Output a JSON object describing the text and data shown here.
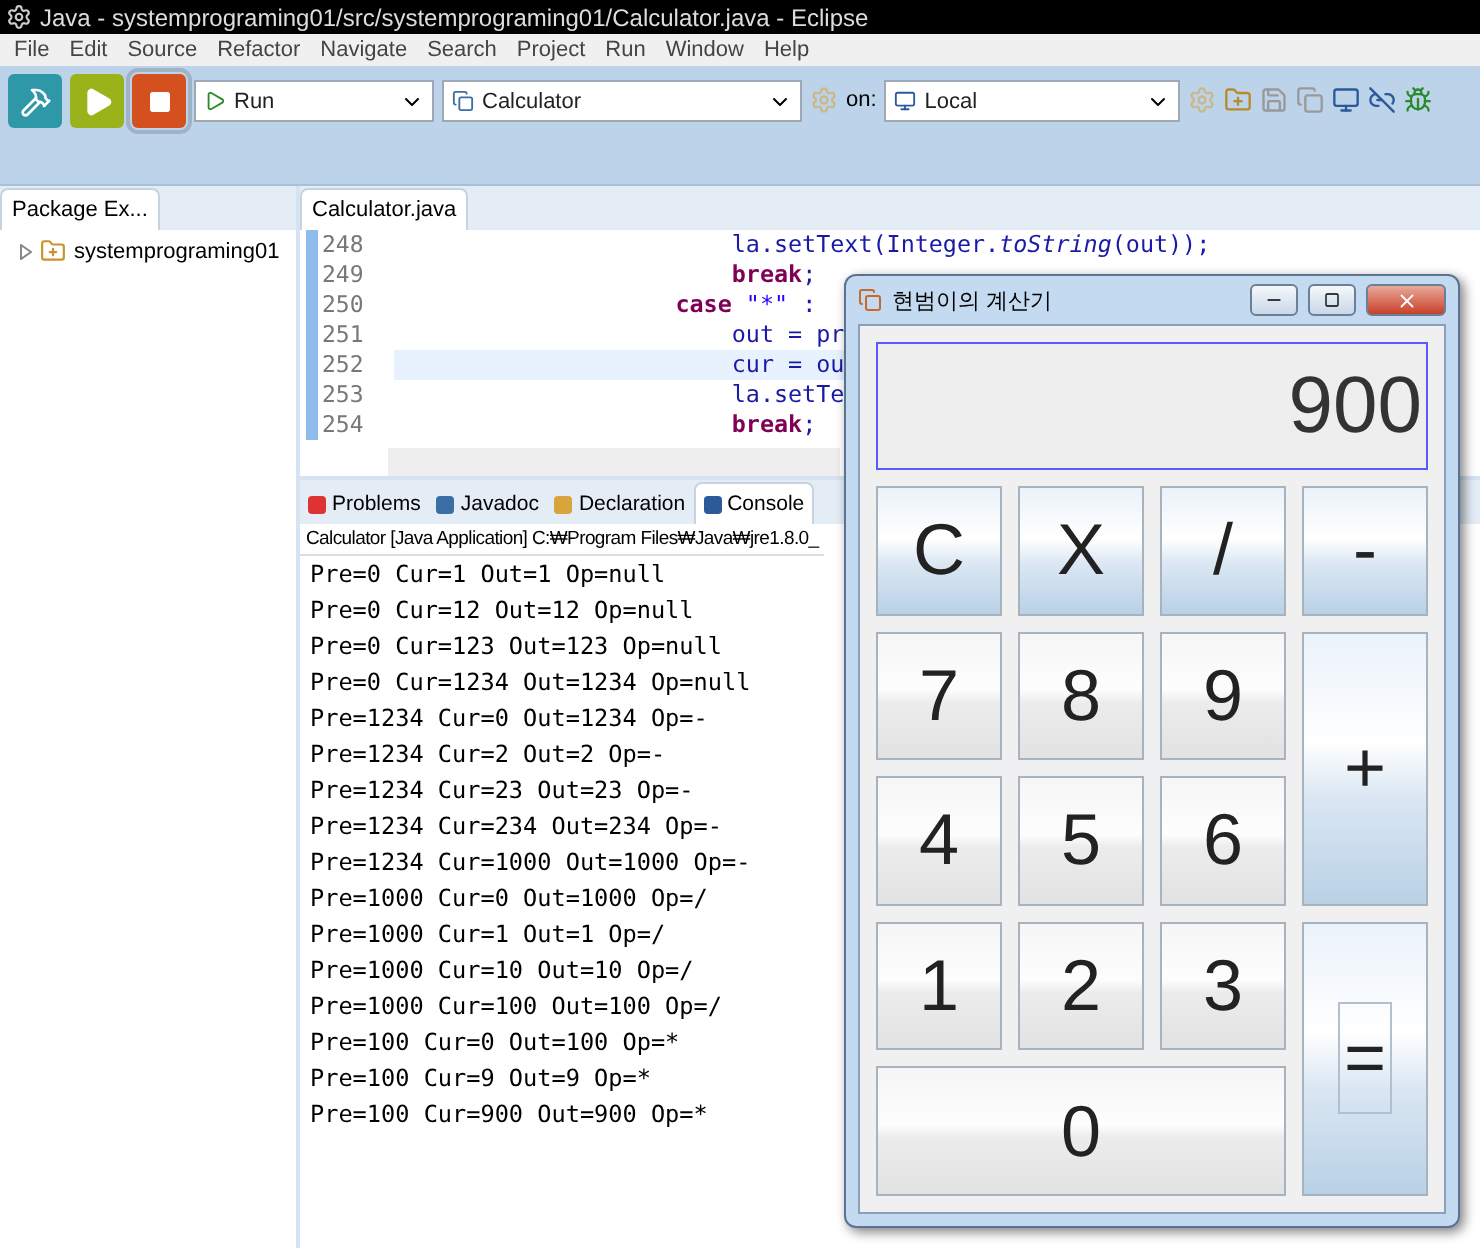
{
  "window": {
    "title": "Java - systemprograming01/src/systemprograming01/Calculator.java - Eclipse"
  },
  "menu": [
    "File",
    "Edit",
    "Source",
    "Refactor",
    "Navigate",
    "Search",
    "Project",
    "Run",
    "Window",
    "Help"
  ],
  "toolbar": {
    "launch_buttons": [
      {
        "kind": "build",
        "selected": false
      },
      {
        "kind": "run",
        "selected": false
      },
      {
        "kind": "stop",
        "selected": true
      }
    ],
    "mode": "Run",
    "config": "Calculator",
    "on_label": "on:",
    "target": "Local"
  },
  "package_explorer": {
    "tab": "Package Ex...",
    "tree": [
      {
        "label": "systemprograming01",
        "expanded": false
      }
    ]
  },
  "editor": {
    "tab": "Calculator.java",
    "lines": [
      {
        "number": "248",
        "current": false,
        "tokens": [
          {
            "kind": "plain",
            "text": "                        la.setText(Integer."
          },
          {
            "kind": "italic",
            "text": "toString"
          },
          {
            "kind": "plain",
            "text": "(out));"
          }
        ]
      },
      {
        "number": "249",
        "current": false,
        "tokens": [
          {
            "kind": "keyword",
            "text": "                        break"
          },
          {
            "kind": "plain",
            "text": ";"
          }
        ]
      },
      {
        "number": "250",
        "current": false,
        "tokens": [
          {
            "kind": "keyword",
            "text": "                    case "
          },
          {
            "kind": "string",
            "text": "\"*\""
          },
          {
            "kind": "plain",
            "text": " :"
          }
        ]
      },
      {
        "number": "251",
        "current": false,
        "tokens": [
          {
            "kind": "plain",
            "text": "                        out = pr"
          }
        ]
      },
      {
        "number": "252",
        "current": true,
        "tokens": [
          {
            "kind": "plain",
            "text": "                        cur = ou"
          }
        ]
      },
      {
        "number": "253",
        "current": false,
        "tokens": [
          {
            "kind": "plain",
            "text": "                        la.setTe"
          }
        ]
      },
      {
        "number": "254",
        "current": false,
        "tokens": [
          {
            "kind": "keyword",
            "text": "                        break"
          },
          {
            "kind": "plain",
            "text": ";"
          }
        ]
      }
    ]
  },
  "bottom_tabs": [
    {
      "label": "Problems",
      "kind": "problems",
      "selected": false
    },
    {
      "label": "Javadoc",
      "kind": "javadoc",
      "selected": false
    },
    {
      "label": "Declaration",
      "kind": "declaration",
      "selected": false
    },
    {
      "label": "Console",
      "kind": "console",
      "selected": true
    }
  ],
  "console": {
    "header": "Calculator [Java Application] C:₩Program Files₩Java₩jre1.8.0_",
    "lines": [
      "Pre=0 Cur=1 Out=1 Op=null",
      "Pre=0 Cur=12 Out=12 Op=null",
      "Pre=0 Cur=123 Out=123 Op=null",
      "Pre=0 Cur=1234 Out=1234 Op=null",
      "Pre=1234 Cur=0 Out=1234 Op=-",
      "Pre=1234 Cur=2 Out=2 Op=-",
      "Pre=1234 Cur=23 Out=23 Op=-",
      "Pre=1234 Cur=234 Out=234 Op=-",
      "Pre=1234 Cur=1000 Out=1000 Op=-",
      "Pre=1000 Cur=0 Out=1000 Op=/",
      "Pre=1000 Cur=1 Out=1 Op=/",
      "Pre=1000 Cur=10 Out=10 Op=/",
      "Pre=1000 Cur=100 Out=100 Op=/",
      "Pre=100 Cur=0 Out=100 Op=*",
      "Pre=100 Cur=9 Out=9 Op=*",
      "Pre=100 Cur=900 Out=900 Op=*"
    ]
  },
  "calculator": {
    "title": "현범이의 계산기",
    "display": "900",
    "buttons": [
      {
        "label": "C",
        "kind": "op"
      },
      {
        "label": "X",
        "kind": "op"
      },
      {
        "label": "/",
        "kind": "op"
      },
      {
        "label": "-",
        "kind": "op"
      },
      {
        "label": "7",
        "kind": "digit"
      },
      {
        "label": "8",
        "kind": "digit"
      },
      {
        "label": "9",
        "kind": "digit"
      },
      {
        "label": "+",
        "kind": "plus"
      },
      {
        "label": "4",
        "kind": "digit"
      },
      {
        "label": "5",
        "kind": "digit"
      },
      {
        "label": "6",
        "kind": "digit"
      },
      {
        "label": "1",
        "kind": "digit"
      },
      {
        "label": "2",
        "kind": "digit"
      },
      {
        "label": "3",
        "kind": "digit"
      },
      {
        "label": "=",
        "kind": "equals"
      },
      {
        "label": "0",
        "kind": "zero"
      }
    ]
  }
}
